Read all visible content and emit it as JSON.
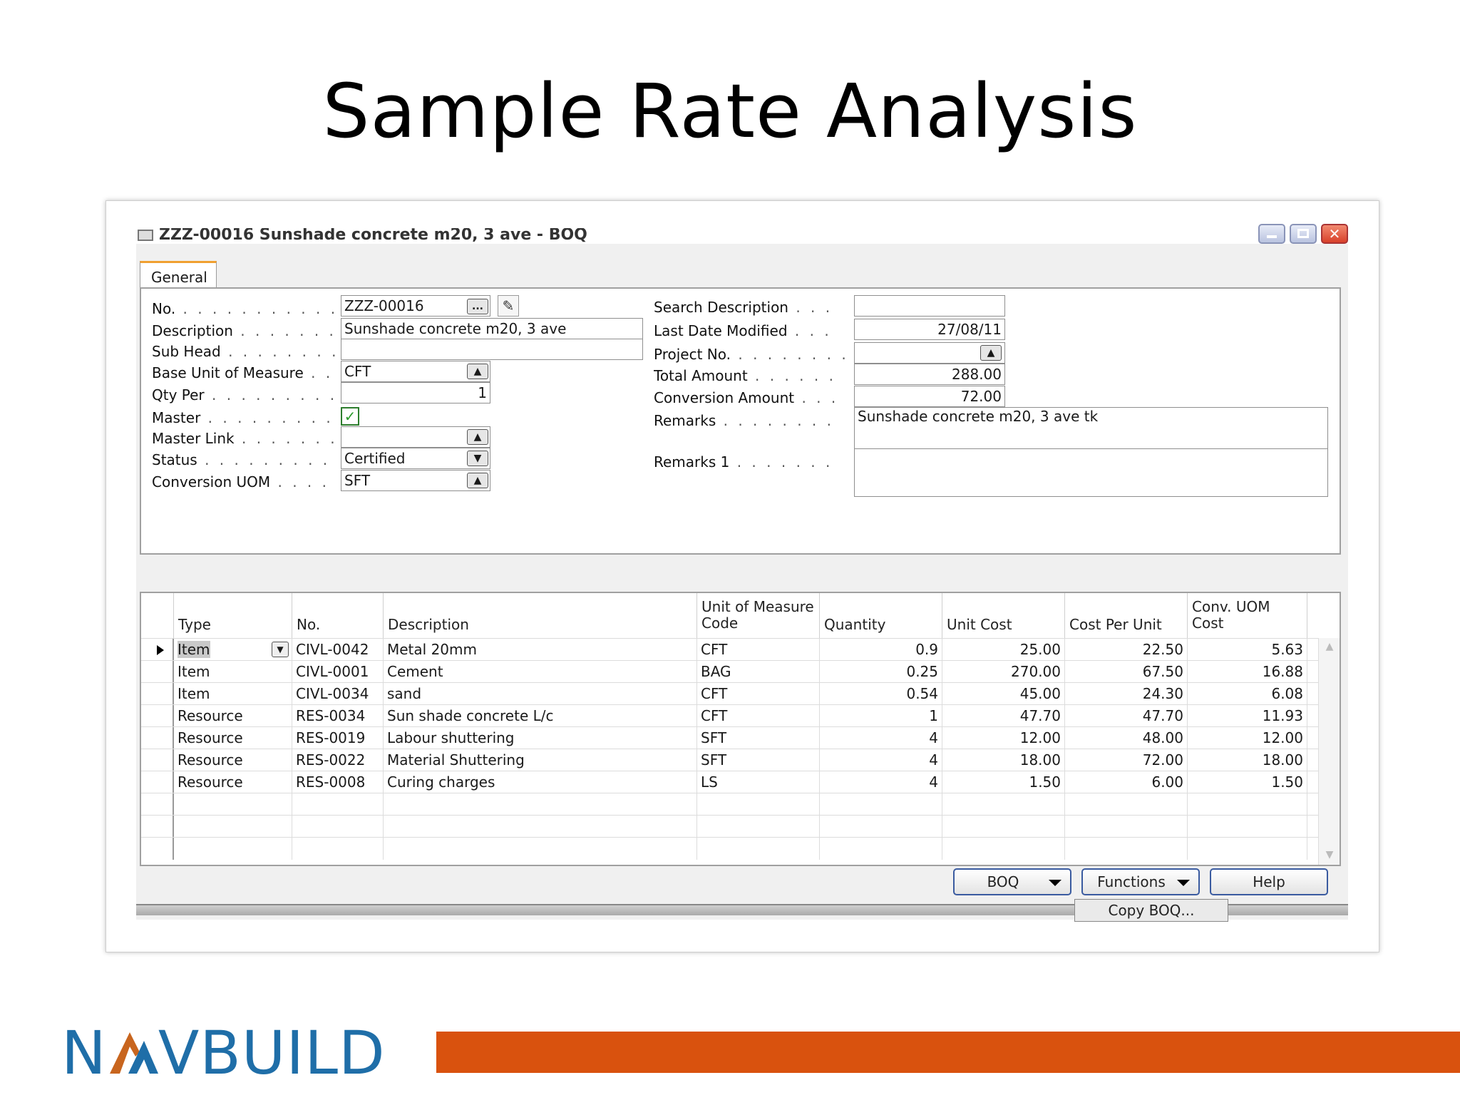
{
  "slide": {
    "title": "Sample Rate Analysis",
    "logo_text_left": "N",
    "logo_text_right": "VBUILD",
    "accent_color": "#d9520e",
    "logo_color": "#1f6ea8"
  },
  "window": {
    "title": "ZZZ-00016 Sunshade concrete  m20, 3  ave - BOQ",
    "close_glyph": "✕"
  },
  "tabs": [
    "General"
  ],
  "form": {
    "no": {
      "label": "No.",
      "value": "ZZZ-00016"
    },
    "description": {
      "label": "Description",
      "value": "Sunshade concrete  m20, 3  ave"
    },
    "sub_head": {
      "label": "Sub Head",
      "value": ""
    },
    "base_uom": {
      "label": "Base Unit of Measure",
      "value": "CFT"
    },
    "qty_per": {
      "label": "Qty Per",
      "value": "1"
    },
    "master": {
      "label": "Master",
      "checked": true
    },
    "master_link": {
      "label": "Master Link",
      "value": ""
    },
    "status": {
      "label": "Status",
      "value": "Certified"
    },
    "conversion_uom": {
      "label": "Conversion UOM",
      "value": "SFT"
    },
    "search_description": {
      "label": "Search Description",
      "value": ""
    },
    "last_date_modified": {
      "label": "Last Date Modified",
      "value": "27/08/11"
    },
    "project_no": {
      "label": "Project No.",
      "value": ""
    },
    "total_amount": {
      "label": "Total Amount",
      "value": "288.00"
    },
    "conversion_amount": {
      "label": "Conversion Amount",
      "value": "72.00"
    },
    "remarks": {
      "label": "Remarks",
      "value": "Sunshade concrete  m20, 3  ave tk"
    },
    "remarks1": {
      "label": "Remarks 1",
      "value": ""
    }
  },
  "grid": {
    "headers": {
      "type": "Type",
      "no": "No.",
      "description": "Description",
      "uom_line1": "Unit of Measure",
      "uom_line2": "Code",
      "quantity": "Quantity",
      "unit_cost": "Unit Cost",
      "cost_per_unit": "Cost Per Unit",
      "conv_line1": "Conv. UOM",
      "conv_line2": "Cost"
    },
    "rows": [
      {
        "type": "Item",
        "no": "CIVL-0042",
        "description": "Metal 20mm",
        "uom": "CFT",
        "quantity": "0.9",
        "unit_cost": "25.00",
        "cost_per_unit": "22.50",
        "conv_cost": "5.63"
      },
      {
        "type": "Item",
        "no": "CIVL-0001",
        "description": "Cement",
        "uom": "BAG",
        "quantity": "0.25",
        "unit_cost": "270.00",
        "cost_per_unit": "67.50",
        "conv_cost": "16.88"
      },
      {
        "type": "Item",
        "no": "CIVL-0034",
        "description": "sand",
        "uom": "CFT",
        "quantity": "0.54",
        "unit_cost": "45.00",
        "cost_per_unit": "24.30",
        "conv_cost": "6.08"
      },
      {
        "type": "Resource",
        "no": "RES-0034",
        "description": "Sun shade concrete  L/c",
        "uom": "CFT",
        "quantity": "1",
        "unit_cost": "47.70",
        "cost_per_unit": "47.70",
        "conv_cost": "11.93"
      },
      {
        "type": "Resource",
        "no": "RES-0019",
        "description": "Labour shuttering",
        "uom": "SFT",
        "quantity": "4",
        "unit_cost": "12.00",
        "cost_per_unit": "48.00",
        "conv_cost": "12.00"
      },
      {
        "type": "Resource",
        "no": "RES-0022",
        "description": "Material Shuttering",
        "uom": "SFT",
        "quantity": "4",
        "unit_cost": "18.00",
        "cost_per_unit": "72.00",
        "conv_cost": "18.00"
      },
      {
        "type": "Resource",
        "no": "RES-0008",
        "description": "Curing charges",
        "uom": "LS",
        "quantity": "4",
        "unit_cost": "1.50",
        "cost_per_unit": "6.00",
        "conv_cost": "1.50"
      }
    ]
  },
  "buttons": {
    "boq": "BOQ",
    "functions": "Functions",
    "help": "Help"
  },
  "menu": {
    "copy_boq": "Copy BOQ..."
  },
  "icons": {
    "lookup": "ellipsis-lookup-icon",
    "edit": "pencil-icon",
    "dropdown": "dropdown-arrow-icon",
    "checkbox": "checkmark-icon"
  }
}
